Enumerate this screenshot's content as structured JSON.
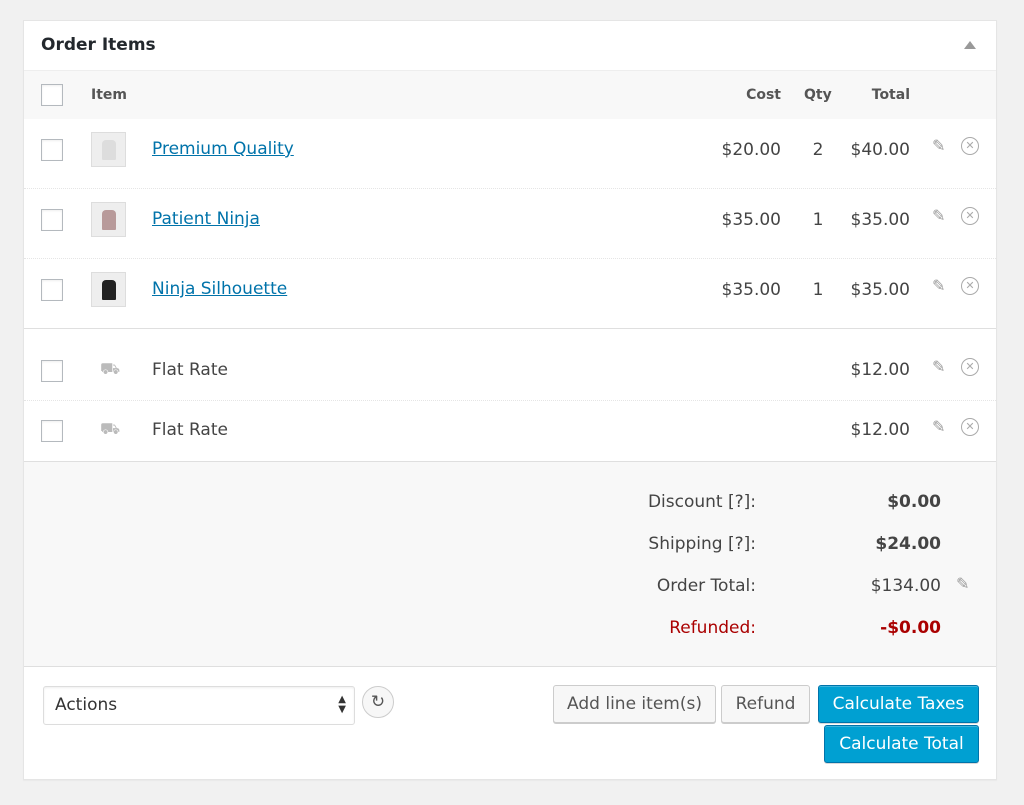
{
  "title": "Order Items",
  "columns": {
    "item": "Item",
    "cost": "Cost",
    "qty": "Qty",
    "total": "Total"
  },
  "items": [
    {
      "name": "Premium Quality",
      "cost": "$20.00",
      "qty": "2",
      "total": "$40.00"
    },
    {
      "name": "Patient Ninja",
      "cost": "$35.00",
      "qty": "1",
      "total": "$35.00"
    },
    {
      "name": "Ninja Silhouette",
      "cost": "$35.00",
      "qty": "1",
      "total": "$35.00"
    }
  ],
  "shipping": [
    {
      "name": "Flat Rate",
      "total": "$12.00"
    },
    {
      "name": "Flat Rate",
      "total": "$12.00"
    }
  ],
  "totals": {
    "discount_label": "Discount [?]:",
    "discount": "$0.00",
    "shipping_label": "Shipping [?]:",
    "shipping": "$24.00",
    "order_total_label": "Order Total:",
    "order_total": "$134.00",
    "refunded_label": "Refunded:",
    "refunded": "-$0.00"
  },
  "footer": {
    "actions": "Actions",
    "add_line": "Add line item(s)",
    "refund": "Refund",
    "calc_taxes": "Calculate Taxes",
    "calc_total": "Calculate Total"
  },
  "colors": {
    "accent": "#00a0d2",
    "link": "#0073aa",
    "refund": "#a00"
  }
}
